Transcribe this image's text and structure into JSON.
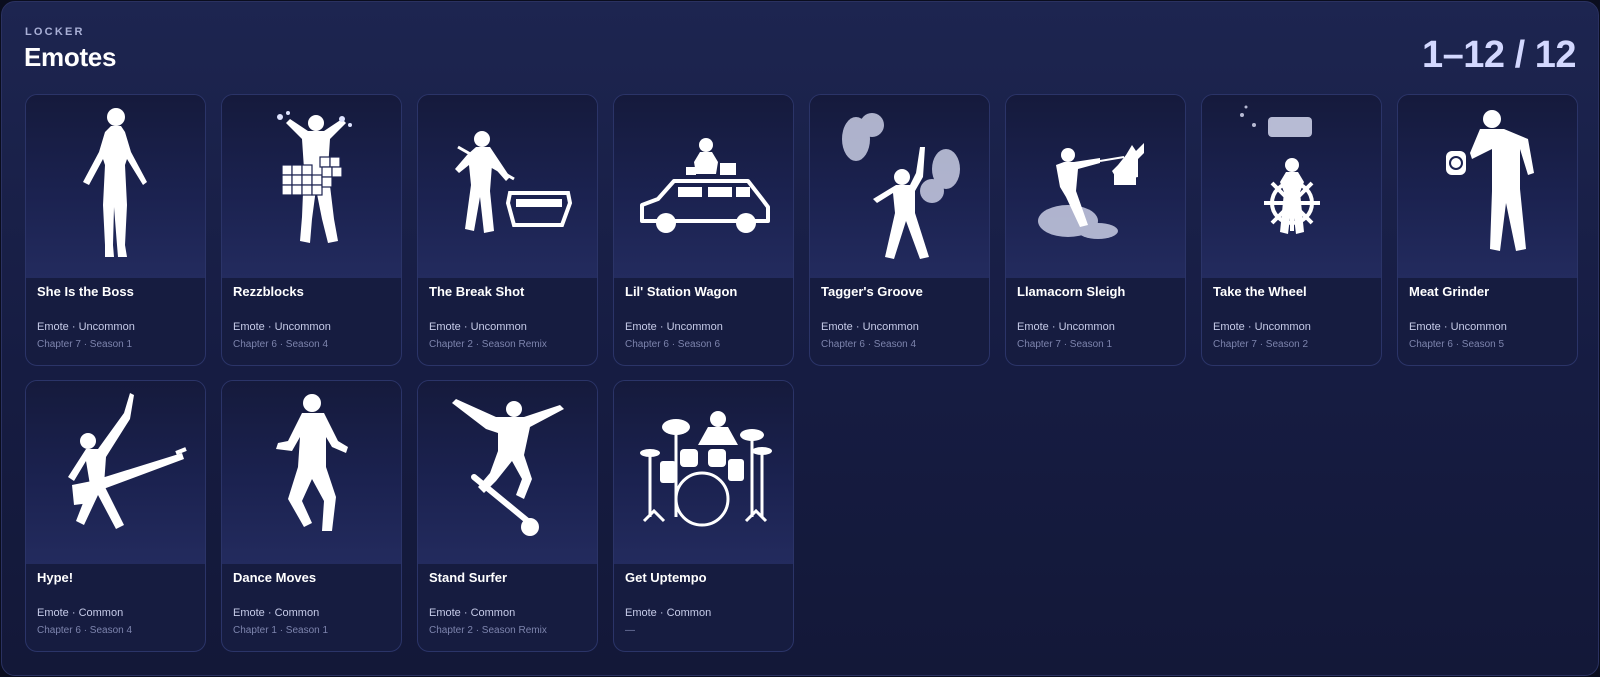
{
  "header": {
    "kicker": "LOCKER",
    "title": "Emotes",
    "count": "1–12 / 12"
  },
  "items": [
    {
      "name": "She Is the Boss",
      "type": "Emote · Uncommon",
      "season": "Chapter 7 · Season 1",
      "icon": "she-is-the-boss-icon"
    },
    {
      "name": "Rezzblocks",
      "type": "Emote · Uncommon",
      "season": "Chapter 6 · Season 4",
      "icon": "rezzblocks-icon"
    },
    {
      "name": "The Break Shot",
      "type": "Emote · Uncommon",
      "season": "Chapter 2 · Season Remix",
      "icon": "the-break-shot-icon"
    },
    {
      "name": "Lil' Station Wagon",
      "type": "Emote · Uncommon",
      "season": "Chapter 6 · Season 6",
      "icon": "station-wagon-icon"
    },
    {
      "name": "Tagger's Groove",
      "type": "Emote · Uncommon",
      "season": "Chapter 6 · Season 4",
      "icon": "taggers-groove-icon"
    },
    {
      "name": "Llamacorn Sleigh",
      "type": "Emote · Uncommon",
      "season": "Chapter 7 · Season 1",
      "icon": "llamacorn-sleigh-icon"
    },
    {
      "name": "Take the Wheel",
      "type": "Emote · Uncommon",
      "season": "Chapter 7 · Season 2",
      "icon": "take-the-wheel-icon"
    },
    {
      "name": "Meat Grinder",
      "type": "Emote · Uncommon",
      "season": "Chapter 6 · Season 5",
      "icon": "meat-grinder-icon"
    },
    {
      "name": "Hype!",
      "type": "Emote · Common",
      "season": "Chapter 6 · Season 4",
      "icon": "hype-icon"
    },
    {
      "name": "Dance Moves",
      "type": "Emote · Common",
      "season": "Chapter 1 · Season 1",
      "icon": "dance-moves-icon"
    },
    {
      "name": "Stand Surfer",
      "type": "Emote · Common",
      "season": "Chapter 2 · Season Remix",
      "icon": "stand-surfer-icon"
    },
    {
      "name": "Get Uptempo",
      "type": "Emote · Common",
      "season": "—",
      "icon": "get-uptempo-icon"
    }
  ]
}
